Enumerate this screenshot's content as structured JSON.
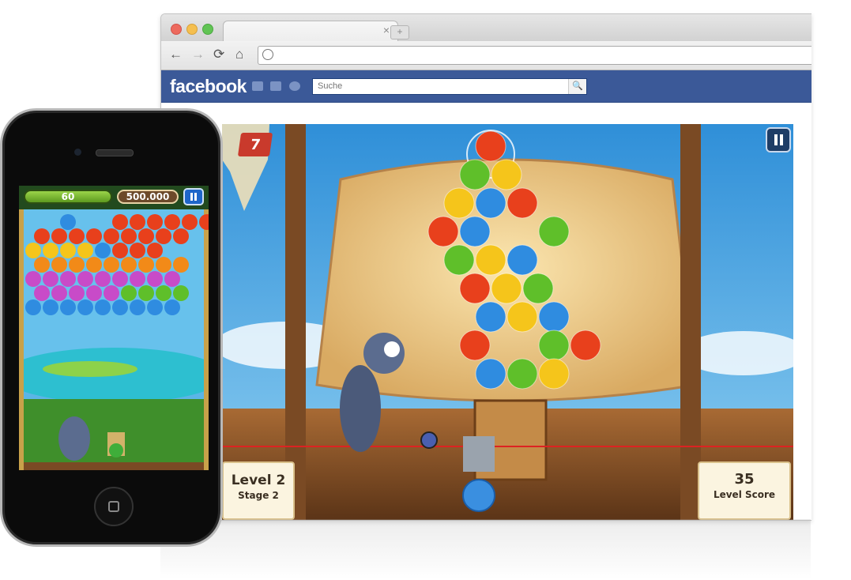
{
  "browser": {
    "tab_close": "×",
    "new_tab": "+",
    "nav": {
      "back": "←",
      "forward": "→",
      "reload": "⟳",
      "home": "⌂"
    },
    "traffic_colors": [
      "#ed6a5e",
      "#f5bf4f",
      "#61c454"
    ]
  },
  "facebook": {
    "logo": "facebook",
    "search_placeholder": "Suche",
    "search_value": "",
    "search_icon": "🔍",
    "brand_color": "#3b5998"
  },
  "game": {
    "lives_badge": "7",
    "level_line1": "Level 2",
    "level_line2": "Stage 2",
    "score_value": "35",
    "score_label": "Level Score",
    "pause_icon": "pause-icon"
  },
  "phone": {
    "moves": "60",
    "target_score": "500.000"
  }
}
